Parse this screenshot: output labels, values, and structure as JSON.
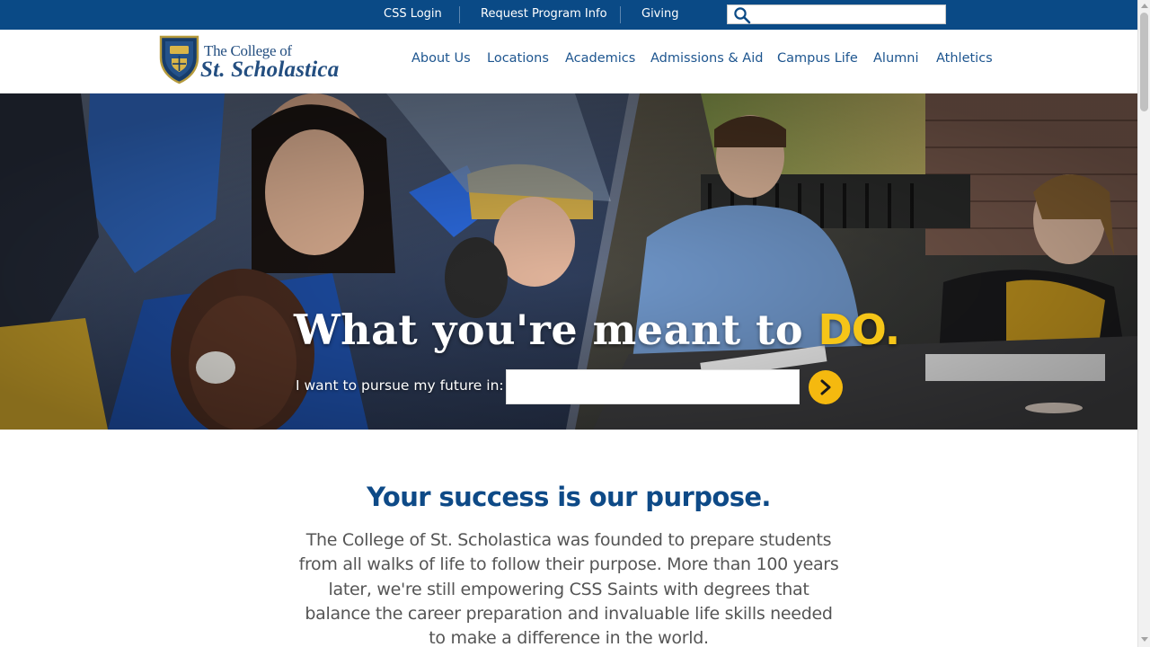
{
  "utility_nav": {
    "links": [
      {
        "label": "CSS Login"
      },
      {
        "label": "Request Program Info"
      },
      {
        "label": "Giving"
      }
    ],
    "search": {
      "value": "",
      "placeholder": ""
    }
  },
  "header": {
    "logo_line1": "The College of",
    "logo_line2": "St. Scholastica",
    "nav": [
      {
        "label": "About Us"
      },
      {
        "label": "Locations"
      },
      {
        "label": "Academics"
      },
      {
        "label": "Admissions & Aid"
      },
      {
        "label": "Campus Life"
      },
      {
        "label": "Alumni"
      },
      {
        "label": "Athletics"
      }
    ]
  },
  "hero": {
    "heading_main": "What you're meant to ",
    "heading_accent": "DO.",
    "prompt_label": "I want to pursue my future in:",
    "input_value": "",
    "input_placeholder": ""
  },
  "intro": {
    "heading": "Your success is our purpose.",
    "body": "The College of St. Scholastica was founded to prepare students from all walks of life to follow their purpose. More than 100 years later, we're still empowering CSS Saints with degrees that balance the career preparation and invaluable life skills needed to make a difference in the world."
  },
  "colors": {
    "brand_blue": "#0a4a86",
    "nav_blue": "#1d558f",
    "accent_gold": "#f5c518",
    "button_gold": "#f5b90f"
  },
  "icons": [
    "search-icon",
    "crest-icon",
    "chevron-right-icon"
  ]
}
